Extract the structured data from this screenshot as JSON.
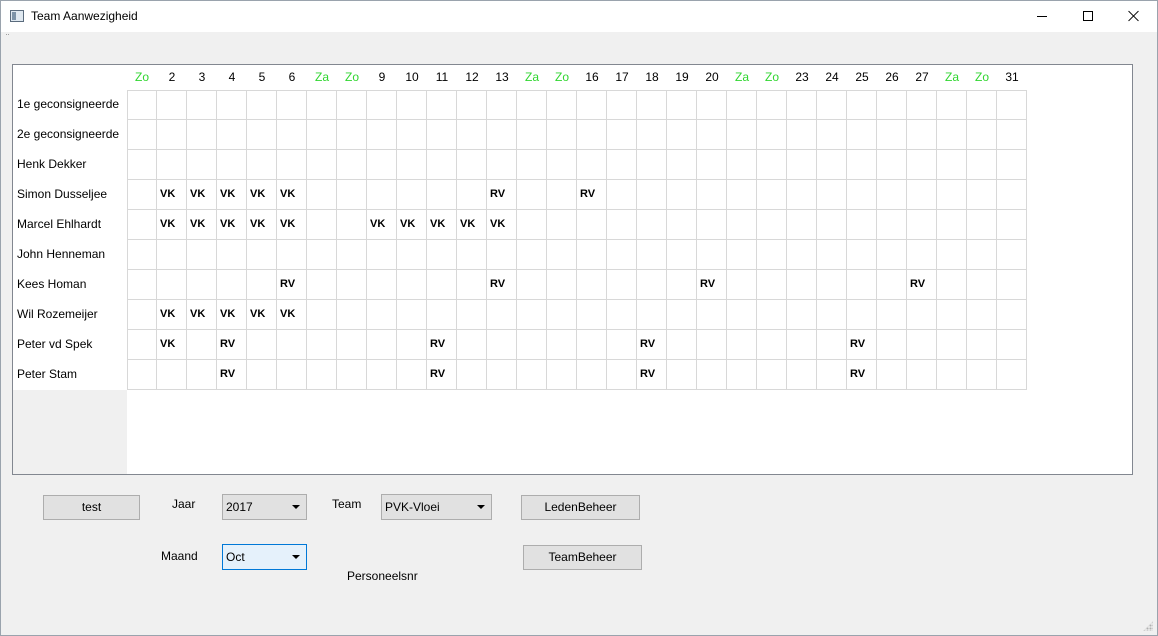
{
  "window": {
    "title": "Team Aanwezigheid"
  },
  "grid": {
    "days": [
      "Zo",
      "2",
      "3",
      "4",
      "5",
      "6",
      "Za",
      "Zo",
      "9",
      "10",
      "11",
      "12",
      "13",
      "Za",
      "Zo",
      "16",
      "17",
      "18",
      "19",
      "20",
      "Za",
      "Zo",
      "23",
      "24",
      "25",
      "26",
      "27",
      "Za",
      "Zo",
      "31"
    ],
    "weekend_color": "#30d630",
    "rows": [
      {
        "name": "1e geconsigneerde",
        "cells": [
          "",
          "",
          "",
          "",
          "",
          "",
          "",
          "",
          "",
          "",
          "",
          "",
          "",
          "",
          "",
          "",
          "",
          "",
          "",
          "",
          "",
          "",
          "",
          "",
          "",
          "",
          "",
          "",
          "",
          ""
        ]
      },
      {
        "name": "2e geconsigneerde",
        "cells": [
          "",
          "",
          "",
          "",
          "",
          "",
          "",
          "",
          "",
          "",
          "",
          "",
          "",
          "",
          "",
          "",
          "",
          "",
          "",
          "",
          "",
          "",
          "",
          "",
          "",
          "",
          "",
          "",
          "",
          ""
        ]
      },
      {
        "name": "Henk Dekker",
        "cells": [
          "",
          "",
          "",
          "",
          "",
          "",
          "",
          "",
          "",
          "",
          "",
          "",
          "",
          "",
          "",
          "",
          "",
          "",
          "",
          "",
          "",
          "",
          "",
          "",
          "",
          "",
          "",
          "",
          "",
          ""
        ]
      },
      {
        "name": "Simon Dusseljee",
        "cells": [
          "",
          "VK",
          "VK",
          "VK",
          "VK",
          "VK",
          "",
          "",
          "",
          "",
          "",
          "",
          "RV",
          "",
          "",
          "RV",
          "",
          "",
          "",
          "",
          "",
          "",
          "",
          "",
          "",
          "",
          "",
          "",
          "",
          ""
        ]
      },
      {
        "name": "Marcel Ehlhardt",
        "cells": [
          "",
          "VK",
          "VK",
          "VK",
          "VK",
          "VK",
          "",
          "",
          "VK",
          "VK",
          "VK",
          "VK",
          "VK",
          "",
          "",
          "",
          "",
          "",
          "",
          "",
          "",
          "",
          "",
          "",
          "",
          "",
          "",
          "",
          "",
          ""
        ]
      },
      {
        "name": "John Henneman",
        "cells": [
          "",
          "",
          "",
          "",
          "",
          "",
          "",
          "",
          "",
          "",
          "",
          "",
          "",
          "",
          "",
          "",
          "",
          "",
          "",
          "",
          "",
          "",
          "",
          "",
          "",
          "",
          "",
          "",
          "",
          ""
        ]
      },
      {
        "name": "Kees Homan",
        "cells": [
          "",
          "",
          "",
          "",
          "",
          "RV",
          "",
          "",
          "",
          "",
          "",
          "",
          "RV",
          "",
          "",
          "",
          "",
          "",
          "",
          "RV",
          "",
          "",
          "",
          "",
          "",
          "",
          "RV",
          "",
          "",
          ""
        ]
      },
      {
        "name": "Wil Rozemeijer",
        "cells": [
          "",
          "VK",
          "VK",
          "VK",
          "VK",
          "VK",
          "",
          "",
          "",
          "",
          "",
          "",
          "",
          "",
          "",
          "",
          "",
          "",
          "",
          "",
          "",
          "",
          "",
          "",
          "",
          "",
          "",
          "",
          "",
          ""
        ]
      },
      {
        "name": "Peter vd Spek",
        "cells": [
          "",
          "VK",
          "",
          "RV",
          "",
          "",
          "",
          "",
          "",
          "",
          "RV",
          "",
          "",
          "",
          "",
          "",
          "",
          "RV",
          "",
          "",
          "",
          "",
          "",
          "",
          "RV",
          "",
          "",
          "",
          "",
          ""
        ]
      },
      {
        "name": "Peter Stam",
        "cells": [
          "",
          "",
          "",
          "RV",
          "",
          "",
          "",
          "",
          "",
          "",
          "RV",
          "",
          "",
          "",
          "",
          "",
          "",
          "RV",
          "",
          "",
          "",
          "",
          "",
          "",
          "RV",
          "",
          "",
          "",
          "",
          ""
        ]
      }
    ]
  },
  "controls": {
    "test_button": "test",
    "jaar_label": "Jaar",
    "jaar_value": "2017",
    "team_label": "Team",
    "team_value": "PVK-Vloei",
    "leden_button": "LedenBeheer",
    "maand_label": "Maand",
    "maand_value": "Oct",
    "team_beheer_button": "TeamBeheer",
    "personeelsnr_label": "Personeelsnr"
  }
}
